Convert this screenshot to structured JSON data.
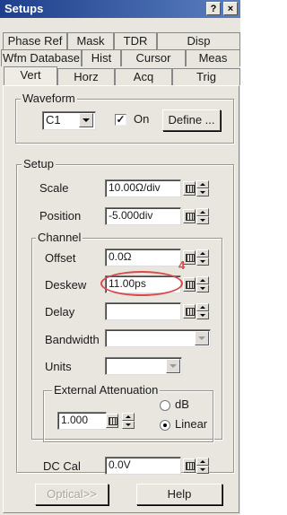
{
  "window": {
    "title": "Setups",
    "help_glyph": "?",
    "close_glyph": "×"
  },
  "tabs": {
    "row1": [
      "Phase Ref",
      "Mask",
      "TDR",
      "Disp"
    ],
    "row2": [
      "Wfm Database",
      "Hist",
      "Cursor",
      "Meas"
    ],
    "row3": [
      "Vert",
      "Horz",
      "Acq",
      "Trig"
    ],
    "active": "Vert"
  },
  "waveform": {
    "group_title": "Waveform",
    "channel": "C1",
    "on_label": "On",
    "on_checked": "✓",
    "define_label": "Define ..."
  },
  "setup": {
    "group_title": "Setup",
    "scale_label": "Scale",
    "scale_value": "10.00Ω/div",
    "position_label": "Position",
    "position_value": "-5.000div"
  },
  "channel": {
    "group_title": "Channel",
    "offset_label": "Offset",
    "offset_value": "0.0Ω",
    "deskew_label": "Deskew",
    "deskew_value": "11.00ps",
    "delay_label": "Delay",
    "delay_value": "",
    "bandwidth_label": "Bandwidth",
    "bandwidth_value": "",
    "units_label": "Units",
    "units_value": ""
  },
  "attenuation": {
    "group_title": "External Attenuation",
    "value": "1.000",
    "db_label": "dB",
    "linear_label": "Linear",
    "selected": "Linear"
  },
  "dccal": {
    "label": "DC Cal",
    "value": "0.0V"
  },
  "buttons": {
    "optical": "Optical>>",
    "help": "Help"
  },
  "annotation": {
    "mark": "4"
  },
  "colors": {
    "title_bar": "#1e3f8c",
    "annotation": "#d94a4a",
    "panel": "#e9e6df"
  }
}
